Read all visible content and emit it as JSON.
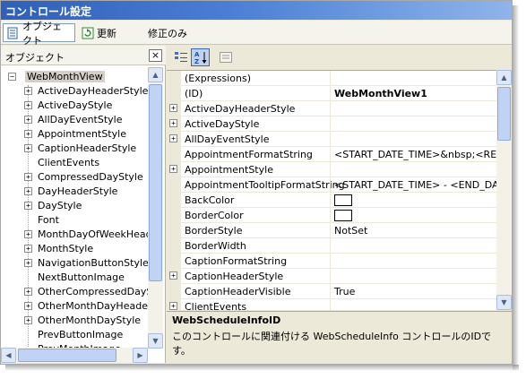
{
  "window": {
    "title": "コントロール設定"
  },
  "toolbar": {
    "object_label": "オブジェクト",
    "refresh_label": "更新",
    "modified_only_label": "修正のみ"
  },
  "left": {
    "header": "オブジェクト",
    "close_glyph": "×",
    "root": "WebMonthView",
    "items": [
      {
        "label": "ActiveDayHeaderStyle",
        "expandable": true
      },
      {
        "label": "ActiveDayStyle",
        "expandable": true
      },
      {
        "label": "AllDayEventStyle",
        "expandable": true
      },
      {
        "label": "AppointmentStyle",
        "expandable": true
      },
      {
        "label": "CaptionHeaderStyle",
        "expandable": true
      },
      {
        "label": "ClientEvents",
        "expandable": false
      },
      {
        "label": "CompressedDayStyle",
        "expandable": true
      },
      {
        "label": "DayHeaderStyle",
        "expandable": true
      },
      {
        "label": "DayStyle",
        "expandable": true
      },
      {
        "label": "Font",
        "expandable": false
      },
      {
        "label": "MonthDayOfWeekHeaderStyle",
        "expandable": true
      },
      {
        "label": "MonthStyle",
        "expandable": true
      },
      {
        "label": "NavigationButtonStyle",
        "expandable": true
      },
      {
        "label": "NextButtonImage",
        "expandable": false
      },
      {
        "label": "OtherCompressedDayStyle",
        "expandable": true
      },
      {
        "label": "OtherMonthDayHeaderStyle",
        "expandable": true
      },
      {
        "label": "OtherMonthDayStyle",
        "expandable": true
      },
      {
        "label": "PrevButtonImage",
        "expandable": false
      },
      {
        "label": "PrevMonthImage",
        "expandable": false
      }
    ]
  },
  "grid": {
    "rows": [
      {
        "name": "(Expressions)",
        "value": "",
        "expandable": false,
        "value_bold": false,
        "swatch": false
      },
      {
        "name": "(ID)",
        "value": "WebMonthView1",
        "expandable": false,
        "value_bold": true,
        "swatch": false
      },
      {
        "name": "ActiveDayHeaderStyle",
        "value": "",
        "expandable": true,
        "value_bold": false,
        "swatch": false
      },
      {
        "name": "ActiveDayStyle",
        "value": "",
        "expandable": true,
        "value_bold": false,
        "swatch": false
      },
      {
        "name": "AllDayEventStyle",
        "value": "",
        "expandable": true,
        "value_bold": false,
        "swatch": false
      },
      {
        "name": "AppointmentFormatString",
        "value": "<START_DATE_TIME>&nbsp;<REMINDER>",
        "expandable": false,
        "value_bold": false,
        "swatch": false
      },
      {
        "name": "AppointmentStyle",
        "value": "",
        "expandable": true,
        "value_bold": false,
        "swatch": false
      },
      {
        "name": "AppointmentTooltipFormatString",
        "value": "<START_DATE_TIME> - <END_DATE_TIME>",
        "expandable": false,
        "value_bold": false,
        "swatch": false
      },
      {
        "name": "BackColor",
        "value": "",
        "expandable": false,
        "value_bold": false,
        "swatch": true
      },
      {
        "name": "BorderColor",
        "value": "",
        "expandable": false,
        "value_bold": false,
        "swatch": true
      },
      {
        "name": "BorderStyle",
        "value": "NotSet",
        "expandable": false,
        "value_bold": false,
        "swatch": false
      },
      {
        "name": "BorderWidth",
        "value": "",
        "expandable": false,
        "value_bold": false,
        "swatch": false
      },
      {
        "name": "CaptionFormatString",
        "value": "",
        "expandable": false,
        "value_bold": false,
        "swatch": false
      },
      {
        "name": "CaptionHeaderStyle",
        "value": "",
        "expandable": true,
        "value_bold": false,
        "swatch": false
      },
      {
        "name": "CaptionHeaderVisible",
        "value": "True",
        "expandable": false,
        "value_bold": false,
        "swatch": false
      },
      {
        "name": "ClientEvents",
        "value": "",
        "expandable": true,
        "value_bold": false,
        "swatch": false
      }
    ]
  },
  "description": {
    "title": "WebScheduleInfoID",
    "text": "このコントロールに関連付ける WebScheduleInfo コントロールのIDです。"
  },
  "glyphs": {
    "plus": "+",
    "minus": "−",
    "arrow_up": "▲",
    "arrow_down": "▼",
    "arrow_left": "◀",
    "arrow_right": "▶"
  }
}
